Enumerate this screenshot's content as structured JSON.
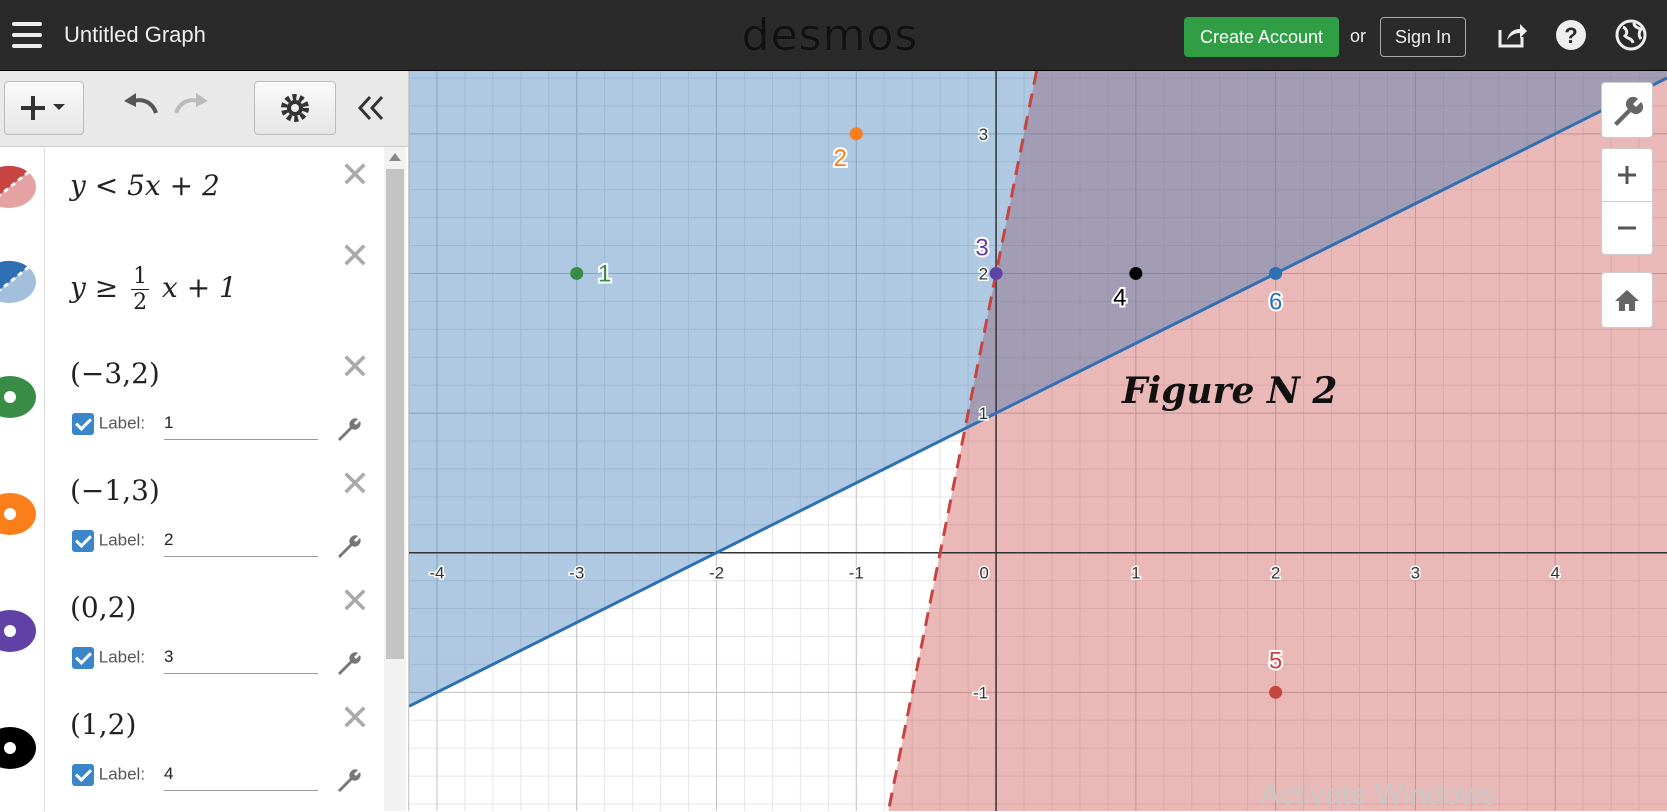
{
  "header": {
    "title": "Untitled Graph",
    "logo": "desmos",
    "create_account": "Create Account",
    "or": "or",
    "sign_in": "Sign In",
    "icons": [
      "share-icon",
      "help-icon",
      "globe-icon"
    ]
  },
  "toolbar": {
    "icons": [
      "add-icon",
      "undo-icon",
      "redo-icon",
      "settings-icon",
      "collapse-icon"
    ]
  },
  "expressions": [
    {
      "latex": "y < 5x + 2",
      "color": "#c74440",
      "style": "dashed"
    },
    {
      "latex_lhs": "y ≥",
      "frac_num": "1",
      "frac_den": "2",
      "latex_rhs": "x + 1",
      "color": "#2d70b3",
      "style": "solid"
    },
    {
      "latex": "(−3,2)",
      "color": "#388c46",
      "label_text": "Label:",
      "label": "1",
      "checked": true
    },
    {
      "latex": "(−1,3)",
      "color": "#fa7e19",
      "label_text": "Label:",
      "label": "2",
      "checked": true
    },
    {
      "latex": "(0,2)",
      "color": "#6042a6",
      "label_text": "Label:",
      "label": "3",
      "checked": true
    },
    {
      "latex": "(1,2)",
      "color": "#000000",
      "label_text": "Label:",
      "label": "4",
      "checked": true
    }
  ],
  "graph": {
    "x_ticks": [
      "-4",
      "-3",
      "-2",
      "-1",
      "0",
      "1",
      "2",
      "3",
      "4"
    ],
    "y_ticks": [
      "3",
      "2",
      "1",
      "-1"
    ],
    "x_range": [
      -4.2,
      4.8
    ],
    "y_range": [
      -1.85,
      3.45
    ],
    "points": [
      {
        "x": -3,
        "y": 2,
        "label": "1",
        "color": "#388c46"
      },
      {
        "x": -1,
        "y": 3,
        "label": "2",
        "color": "#fa7e19"
      },
      {
        "x": 0,
        "y": 2,
        "label": "3",
        "color": "#6042a6"
      },
      {
        "x": 1,
        "y": 2,
        "label": "4",
        "color": "#000000"
      },
      {
        "x": 2,
        "y": -1,
        "label": "5",
        "color": "#c74440"
      },
      {
        "x": 2,
        "y": 2,
        "label": "6",
        "color": "#2d70b3"
      }
    ],
    "annotation": "Figure N 2",
    "side_buttons": [
      "wrench-icon",
      "zoom-in-icon",
      "zoom-out-icon",
      "home-icon"
    ]
  },
  "watermark": "Activate Windows"
}
